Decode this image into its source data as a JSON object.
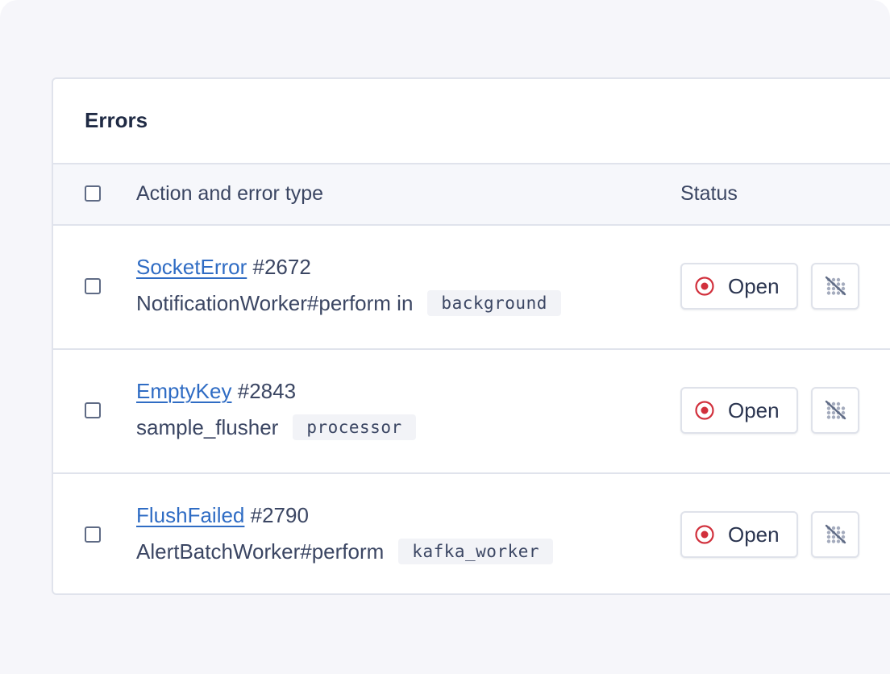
{
  "card": {
    "title": "Errors"
  },
  "table": {
    "columns": {
      "action": "Action and error type",
      "status": "Status"
    },
    "rows": [
      {
        "error_name": "SocketError",
        "error_id": "#2672",
        "action": "NotificationWorker#perform in",
        "tag": "background",
        "status": "Open"
      },
      {
        "error_name": "EmptyKey",
        "error_id": "#2843",
        "action": "sample_flusher",
        "tag": "processor",
        "status": "Open"
      },
      {
        "error_name": "FlushFailed",
        "error_id": "#2790",
        "action": "AlertBatchWorker#perform",
        "tag": "kafka_worker",
        "status": "Open"
      }
    ]
  },
  "icons": {
    "status_open": "open-status-icon",
    "mute": "mute-icon"
  },
  "colors": {
    "link": "#2f6cc4",
    "status_open": "#d1303c",
    "background": "#f6f6fa",
    "border": "#e0e3ec"
  }
}
